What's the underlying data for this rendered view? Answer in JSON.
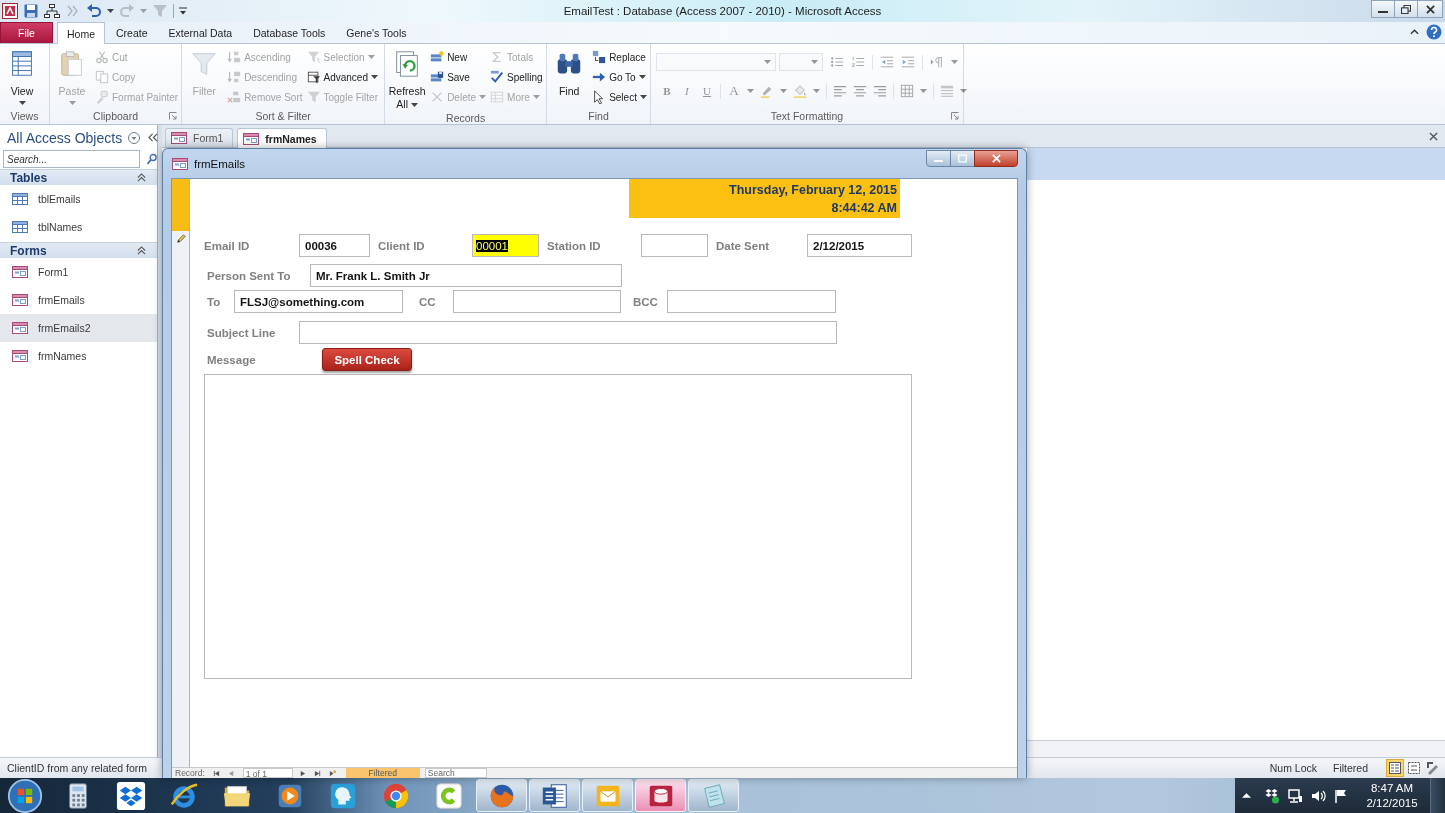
{
  "title_bar": {
    "title": "EmailTest : Database (Access 2007 - 2010) - Microsoft Access",
    "quick_access": [
      {
        "disabled": false
      },
      {
        "disabled": false
      },
      {
        "disabled": true
      },
      {
        "disabled": false
      },
      {
        "disabled": true
      },
      {
        "disabled": true
      }
    ]
  },
  "ribbon": {
    "tabs": [
      {
        "label": "File",
        "kind": "file",
        "selected": false
      },
      {
        "label": "Home",
        "kind": "tab",
        "selected": true
      },
      {
        "label": "Create",
        "kind": "tab",
        "selected": false
      },
      {
        "label": "External Data",
        "kind": "tab",
        "selected": false
      },
      {
        "label": "Database Tools",
        "kind": "tab",
        "selected": false
      },
      {
        "label": "Gene's Tools",
        "kind": "tab",
        "selected": false
      }
    ],
    "groups": [
      {
        "label": "Views",
        "launcher": false,
        "large": {
          "label": "View",
          "disabled": false,
          "dropdown": true
        }
      },
      {
        "label": "Clipboard",
        "launcher": true,
        "large": {
          "label": "Paste",
          "disabled": true,
          "dropdown": true
        },
        "columns": [
          [
            {
              "label": "Cut",
              "disabled": true,
              "dropdown": false
            },
            {
              "label": "Copy",
              "disabled": true,
              "dropdown": false
            },
            {
              "label": "Format Painter",
              "disabled": true,
              "dropdown": false
            }
          ]
        ]
      },
      {
        "label": "Sort & Filter",
        "launcher": false,
        "large": {
          "label": "Filter",
          "disabled": true,
          "dropdown": false
        },
        "columns": [
          [
            {
              "label": "Ascending",
              "disabled": true,
              "dropdown": false
            },
            {
              "label": "Descending",
              "disabled": true,
              "dropdown": false
            },
            {
              "label": "Remove Sort",
              "disabled": true,
              "dropdown": false
            }
          ],
          [
            {
              "label": "Selection",
              "disabled": true,
              "dropdown": true
            },
            {
              "label": "Advanced",
              "disabled": false,
              "dropdown": true
            },
            {
              "label": "Toggle Filter",
              "disabled": true,
              "dropdown": false
            }
          ]
        ]
      },
      {
        "label": "Records",
        "launcher": false,
        "large": {
          "label": "Refresh All",
          "disabled": false,
          "dropdown": true
        },
        "columns": [
          [
            {
              "label": "New",
              "disabled": false,
              "dropdown": false
            },
            {
              "label": "Save",
              "disabled": false,
              "dropdown": false
            },
            {
              "label": "Delete",
              "disabled": true,
              "dropdown": true
            }
          ],
          [
            {
              "label": "Totals",
              "disabled": true,
              "dropdown": false
            },
            {
              "label": "Spelling",
              "disabled": false,
              "dropdown": false
            },
            {
              "label": "More",
              "disabled": true,
              "dropdown": true
            }
          ]
        ]
      },
      {
        "label": "Find",
        "launcher": false,
        "large": {
          "label": "Find",
          "disabled": false,
          "dropdown": false
        },
        "columns": [
          [
            {
              "label": "Replace",
              "disabled": false,
              "dropdown": false
            },
            {
              "label": "Go To",
              "disabled": false,
              "dropdown": true
            },
            {
              "label": "Select",
              "disabled": false,
              "dropdown": true
            }
          ]
        ]
      }
    ],
    "text_formatting": {
      "label": "Text Formatting",
      "launcher": true,
      "disabled": true,
      "style_buttons": [
        "B",
        "I",
        "U"
      ],
      "font_color": "A"
    }
  },
  "nav_pane": {
    "title": "All Access Objects",
    "search": {
      "placeholder": "Search..."
    },
    "groups": [
      {
        "label": "Tables",
        "kind": "table",
        "expanded": true,
        "items": [
          {
            "label": "tblEmails",
            "selected": false
          },
          {
            "label": "tblNames",
            "selected": false
          }
        ]
      },
      {
        "label": "Forms",
        "kind": "form",
        "expanded": true,
        "items": [
          {
            "label": "Form1",
            "selected": false
          },
          {
            "label": "frmEmails",
            "selected": false
          },
          {
            "label": "frmEmails2",
            "selected": true
          },
          {
            "label": "frmNames",
            "selected": false
          }
        ]
      }
    ]
  },
  "document_tabs": [
    {
      "label": "Form1",
      "selected": false
    },
    {
      "label": "frmNames",
      "selected": true
    }
  ],
  "form_window": {
    "title": "frmEmails",
    "editing": true,
    "header": {
      "date": "Thursday, February 12, 2015",
      "time": "8:44:42 AM"
    },
    "rows": [
      [
        {
          "label": "Email ID",
          "value": "00036",
          "focused": false
        },
        {
          "label": "Client ID",
          "value": "00001",
          "focused": true
        },
        {
          "label": "Station ID",
          "focused": false
        },
        {
          "label": "Date Sent",
          "value": "2/12/2015",
          "focused": false
        }
      ],
      [
        {
          "label": "Person Sent To",
          "value": "Mr. Frank L. Smith Jr",
          "focused": false
        }
      ],
      [
        {
          "label": "To",
          "value": "FLSJ@something.com",
          "focused": false
        },
        {
          "label": "CC",
          "focused": false
        },
        {
          "label": "BCC",
          "focused": false
        }
      ],
      [
        {
          "label": "Subject Line",
          "focused": false
        }
      ]
    ],
    "message": {
      "label": "Message",
      "button": "Spell Check"
    },
    "record_nav": {
      "label": "Record:",
      "position": "1 of 1",
      "filter": "Filtered",
      "filter_active": true,
      "search": {
        "placeholder": "Search"
      }
    }
  },
  "status_bar": {
    "message": "ClientID from any related form",
    "indicators": [
      "Num Lock",
      "Filtered"
    ],
    "views": [
      {
        "selected": true
      },
      {
        "selected": false
      },
      {
        "selected": false
      }
    ]
  },
  "taskbar": {
    "apps": [
      {
        "running": false,
        "selected": false
      },
      {
        "running": false,
        "selected": false
      },
      {
        "running": false,
        "selected": false
      },
      {
        "running": false,
        "selected": false
      },
      {
        "running": false,
        "selected": false
      },
      {
        "running": false,
        "selected": false
      },
      {
        "running": false,
        "selected": false
      },
      {
        "running": false,
        "selected": false
      },
      {
        "running": true,
        "selected": false
      },
      {
        "running": true,
        "selected": false
      },
      {
        "running": true,
        "selected": false
      },
      {
        "running": true,
        "selected": true
      },
      {
        "running": true,
        "selected": false
      }
    ],
    "clock": {
      "time": "8:47 AM",
      "date": "2/12/2015"
    }
  }
}
